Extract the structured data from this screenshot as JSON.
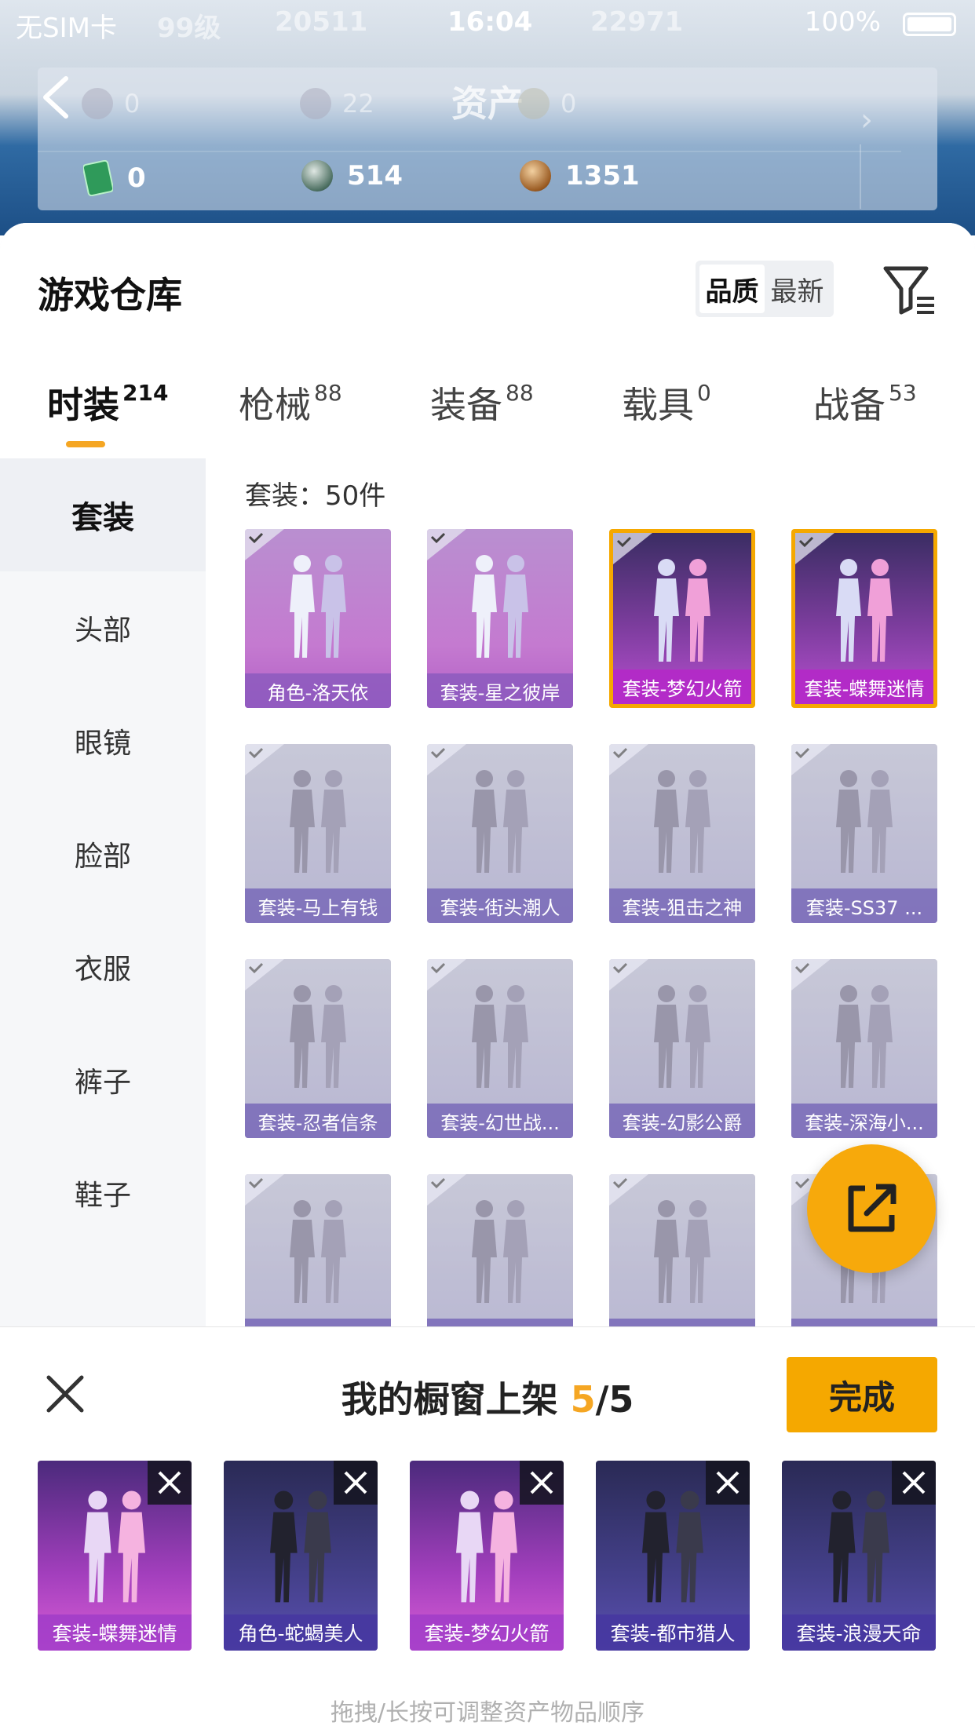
{
  "status_bar": {
    "carrier": "无SIM卡",
    "time": "16:04",
    "battery": "100%"
  },
  "faint_overlay": {
    "level": "99级",
    "value_a": "20511",
    "value_b": "22971"
  },
  "asset_header": {
    "title": "资产",
    "top_values": [
      "0",
      "22",
      "0"
    ],
    "values": [
      "0",
      "514",
      "1351"
    ]
  },
  "warehouse": {
    "title": "游戏仓库",
    "sort_options": [
      "品质",
      "最新"
    ],
    "active_sort": "品质"
  },
  "tabs": [
    {
      "label": "时装",
      "count": "214"
    },
    {
      "label": "枪械",
      "count": "88"
    },
    {
      "label": "装备",
      "count": "88"
    },
    {
      "label": "载具",
      "count": "0"
    },
    {
      "label": "战备",
      "count": "53"
    }
  ],
  "categories": [
    "套装",
    "头部",
    "眼镜",
    "脸部",
    "衣服",
    "裤子",
    "鞋子"
  ],
  "grid": {
    "count_label": "套装：50件",
    "items": [
      {
        "label": "角色-洛天依",
        "style": "purple"
      },
      {
        "label": "套装-星之彼岸",
        "style": "purple"
      },
      {
        "label": "套装-梦幻火箭",
        "style": "gold"
      },
      {
        "label": "套装-蝶舞迷情",
        "style": "gold"
      },
      {
        "label": "套装-马上有钱",
        "style": "dim"
      },
      {
        "label": "套装-街头潮人",
        "style": "dim"
      },
      {
        "label": "套装-狙击之神",
        "style": "dim"
      },
      {
        "label": "套装-SS37 ...",
        "style": "dim"
      },
      {
        "label": "套装-忍者信条",
        "style": "dim"
      },
      {
        "label": "套装-幻世战...",
        "style": "dim"
      },
      {
        "label": "套装-幻影公爵",
        "style": "dim"
      },
      {
        "label": "套装-深海小...",
        "style": "dim"
      },
      {
        "label": "",
        "style": "dim"
      },
      {
        "label": "",
        "style": "dim"
      },
      {
        "label": "",
        "style": "dim"
      },
      {
        "label": "",
        "style": "dim"
      }
    ]
  },
  "showcase": {
    "title": "我的橱窗上架",
    "current": "5",
    "separator": "/",
    "max": "5",
    "done_label": "完成",
    "items": [
      {
        "label": "套装-蝶舞迷情",
        "style": "pink"
      },
      {
        "label": "角色-蛇蝎美人",
        "style": "navy"
      },
      {
        "label": "套装-梦幻火箭",
        "style": "pink"
      },
      {
        "label": "套装-都市猎人",
        "style": "navy"
      },
      {
        "label": "套装-浪漫天命",
        "style": "navy"
      }
    ],
    "hint": "拖拽/长按可调整资产物品顺序"
  },
  "colors": {
    "accent": "#f5a800",
    "tab_underline": "#f5a623"
  }
}
